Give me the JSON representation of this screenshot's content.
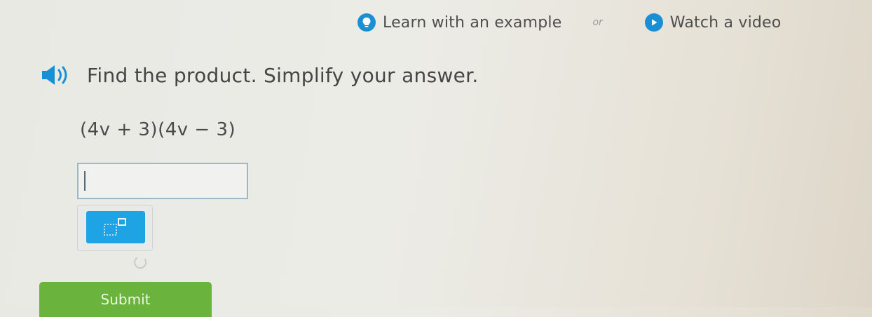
{
  "help": {
    "example_label": "Learn with an example",
    "or_label": "or",
    "video_label": "Watch a video",
    "icon_example": "lightbulb-icon",
    "icon_video": "play-icon"
  },
  "question": {
    "prompt": "Find the product. Simplify your answer.",
    "expression": "(4v + 3)(4v − 3)",
    "speaker_icon": "speaker-icon"
  },
  "answer": {
    "value": "",
    "placeholder": ""
  },
  "palette": {
    "buttons": [
      "exponent-icon"
    ]
  },
  "submit": {
    "label": "Submit"
  },
  "colors": {
    "accent_blue": "#1a8fd6",
    "palette_blue": "#1ea4e4",
    "submit_green": "#6ab43d"
  }
}
